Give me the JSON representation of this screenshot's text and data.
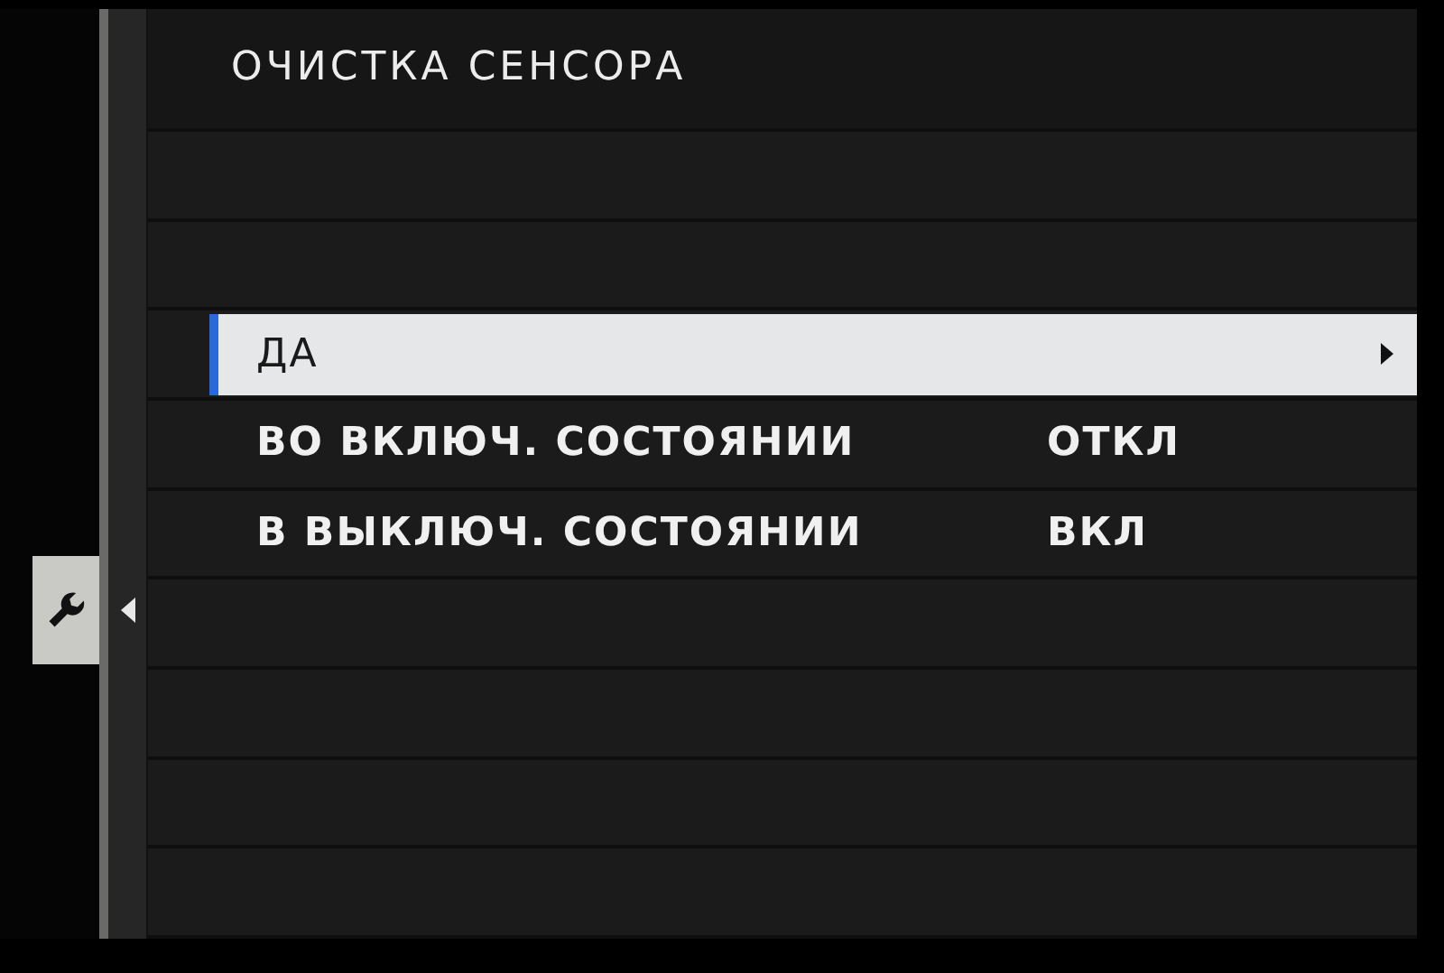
{
  "menu": {
    "title": "ОЧИСТКА СЕНСОРА",
    "items": [
      {
        "label": "ДА",
        "selected": true
      },
      {
        "label": "ВО ВКЛЮЧ. СОСТОЯНИИ",
        "value": "ОТКЛ",
        "selected": false
      },
      {
        "label": "В ВЫКЛЮЧ. СОСТОЯНИИ",
        "value": "ВКЛ",
        "selected": false
      }
    ]
  }
}
